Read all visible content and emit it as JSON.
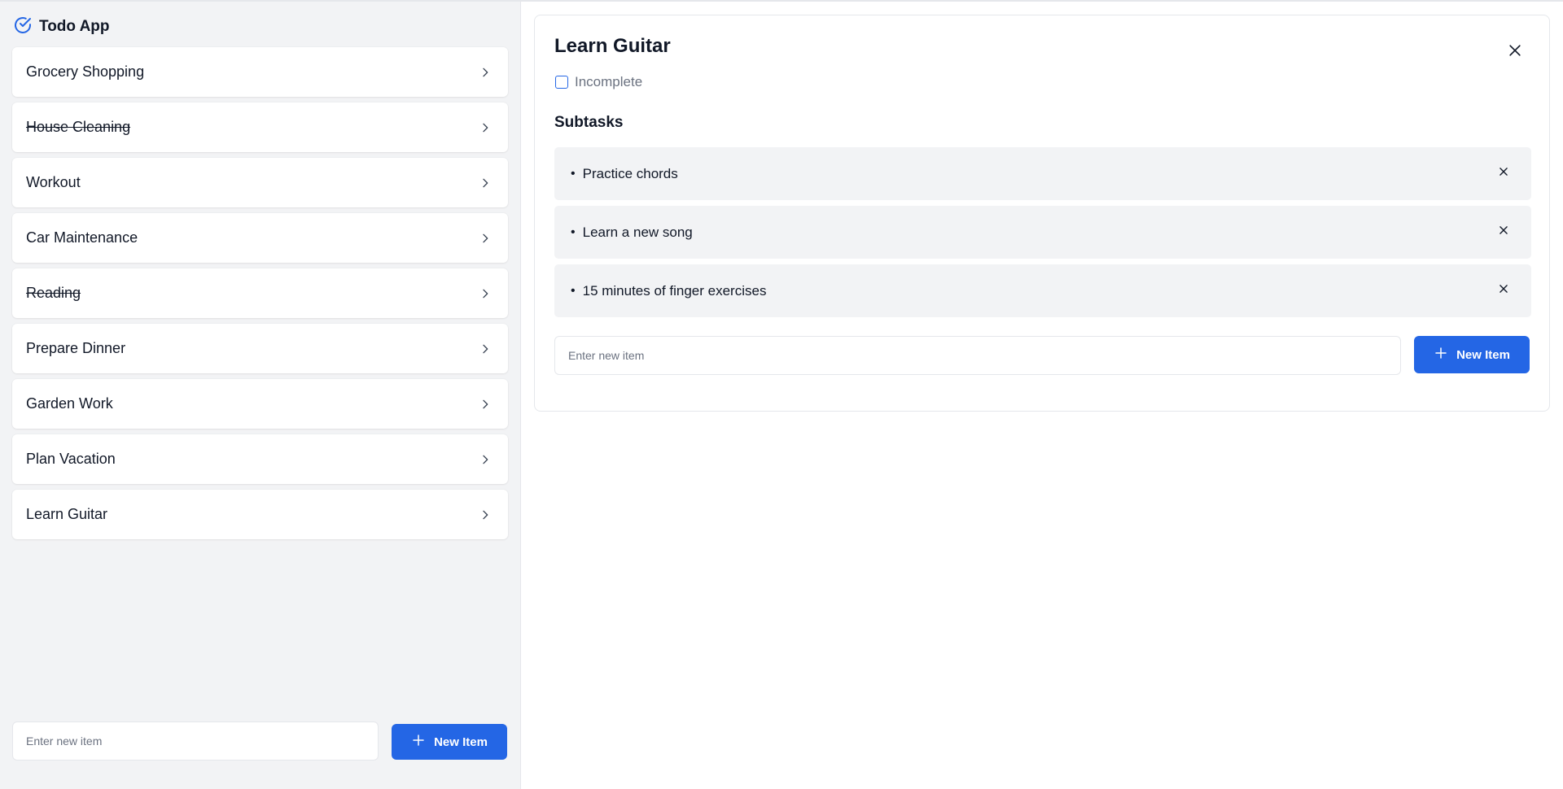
{
  "app": {
    "title": "Todo App",
    "accent_color": "#2466e5"
  },
  "sidebar": {
    "items": [
      {
        "label": "Grocery Shopping",
        "completed": false
      },
      {
        "label": "House Cleaning",
        "completed": true
      },
      {
        "label": "Workout",
        "completed": false
      },
      {
        "label": "Car Maintenance",
        "completed": false
      },
      {
        "label": "Reading",
        "completed": true
      },
      {
        "label": "Prepare Dinner",
        "completed": false
      },
      {
        "label": "Garden Work",
        "completed": false
      },
      {
        "label": "Plan Vacation",
        "completed": false
      },
      {
        "label": "Learn Guitar",
        "completed": false
      }
    ],
    "input_placeholder": "Enter new item",
    "input_value": "",
    "add_button_label": "New Item"
  },
  "detail": {
    "title": "Learn Guitar",
    "status_label": "Incomplete",
    "completed": false,
    "subtasks_heading": "Subtasks",
    "subtasks": [
      {
        "text": "Practice chords"
      },
      {
        "text": "Learn a new song"
      },
      {
        "text": "15 minutes of finger exercises"
      }
    ],
    "input_placeholder": "Enter new item",
    "input_value": "",
    "add_button_label": "New Item"
  },
  "icons": {
    "brand": "check-circle-icon",
    "list_item": "chevron-right-icon",
    "close": "close-icon",
    "remove": "x-icon",
    "add": "plus-icon"
  }
}
